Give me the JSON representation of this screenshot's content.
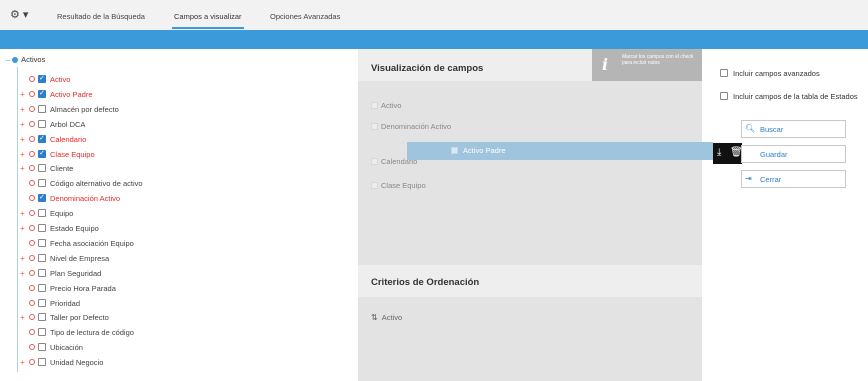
{
  "tabs": [
    {
      "label": "Resultado de la Búsqueda"
    },
    {
      "label": "Campos a visualizar"
    },
    {
      "label": "Opciones Avanzadas"
    }
  ],
  "active_tab": 1,
  "tree": {
    "root": "Activos",
    "items": [
      {
        "label": "Activo",
        "checked": true,
        "expandable": false
      },
      {
        "label": "Activo Padre",
        "checked": true,
        "expandable": true
      },
      {
        "label": "Almacén por defecto",
        "checked": false,
        "expandable": true
      },
      {
        "label": "Arbol DCA",
        "checked": false,
        "expandable": true
      },
      {
        "label": "Calendario",
        "checked": true,
        "expandable": true
      },
      {
        "label": "Clase Equipo",
        "checked": true,
        "expandable": true
      },
      {
        "label": "Cliente",
        "checked": false,
        "expandable": true
      },
      {
        "label": "Código alternativo de activo",
        "checked": false,
        "expandable": false
      },
      {
        "label": "Denominación Activo",
        "checked": true,
        "expandable": false
      },
      {
        "label": "Equipo",
        "checked": false,
        "expandable": true
      },
      {
        "label": "Estado Equipo",
        "checked": false,
        "expandable": true
      },
      {
        "label": "Fecha asociación Equipo",
        "checked": false,
        "expandable": false
      },
      {
        "label": "Nivel de Empresa",
        "checked": false,
        "expandable": true
      },
      {
        "label": "Plan Seguridad",
        "checked": false,
        "expandable": true
      },
      {
        "label": "Precio Hora Parada",
        "checked": false,
        "expandable": false
      },
      {
        "label": "Prioridad",
        "checked": false,
        "expandable": false
      },
      {
        "label": "Taller por Defecto",
        "checked": false,
        "expandable": true
      },
      {
        "label": "Tipo de lectura de código",
        "checked": false,
        "expandable": false
      },
      {
        "label": "Ubicación",
        "checked": false,
        "expandable": false
      },
      {
        "label": "Unidad Negocio",
        "checked": false,
        "expandable": true
      }
    ]
  },
  "visualizacion": {
    "title": "Visualización de campos",
    "info_text": "Marcar los campos con el check para incluir nulos",
    "fields": [
      "Activo",
      "Denominación Activo",
      "Calendario",
      "Clase Equipo"
    ],
    "dragging": "Activo Padre"
  },
  "ordenacion": {
    "title": "Criterios de Ordenación",
    "items": [
      "Activo"
    ]
  },
  "options": {
    "advanced": "Incluir campos avanzados",
    "states_table": "Incluir campos de la tabla de Estados"
  },
  "buttons": {
    "search": "Buscar",
    "save": "Guardar",
    "close": "Cerrar"
  },
  "colors": {
    "accent": "#3b9ad9",
    "required": "#e52a2a"
  }
}
